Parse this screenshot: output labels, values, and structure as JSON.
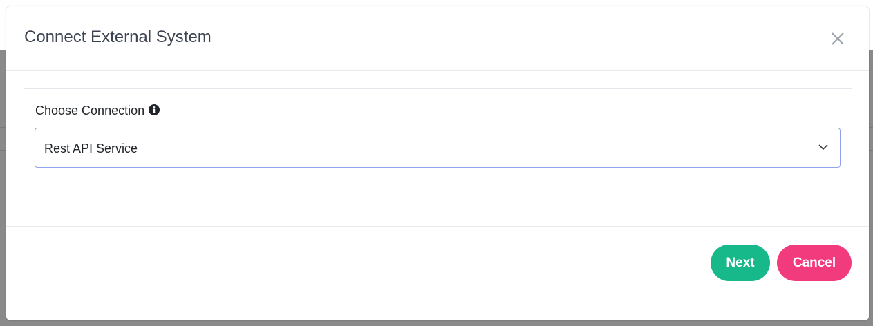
{
  "modal": {
    "title": "Connect External System",
    "close_icon": "close-icon"
  },
  "form": {
    "label": "Choose Connection",
    "info_icon": "info-circle-icon",
    "select": {
      "value": "Rest API Service",
      "chevron_icon": "chevron-down-icon"
    }
  },
  "footer": {
    "next_label": "Next",
    "cancel_label": "Cancel"
  },
  "colors": {
    "next_button": "#17b88a",
    "cancel_button": "#f23b7c",
    "select_border": "#8fa3ee",
    "title_text": "#3d4451"
  }
}
